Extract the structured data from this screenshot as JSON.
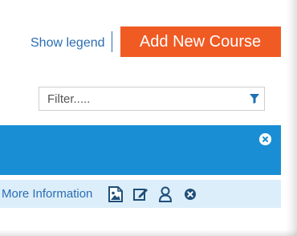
{
  "top": {
    "legend_link": "Show legend",
    "add_button": "Add New Course"
  },
  "filter": {
    "placeholder": "Filter....."
  },
  "row": {
    "more_info_link": "More Information",
    "actions": [
      "image-icon",
      "edit-icon",
      "user-icon",
      "close-circle-icon"
    ]
  },
  "colors": {
    "accent_orange": "#f05a23",
    "header_blue": "#1a8ed4",
    "row_bg": "#dceefa",
    "link_blue": "#2a6db3"
  }
}
